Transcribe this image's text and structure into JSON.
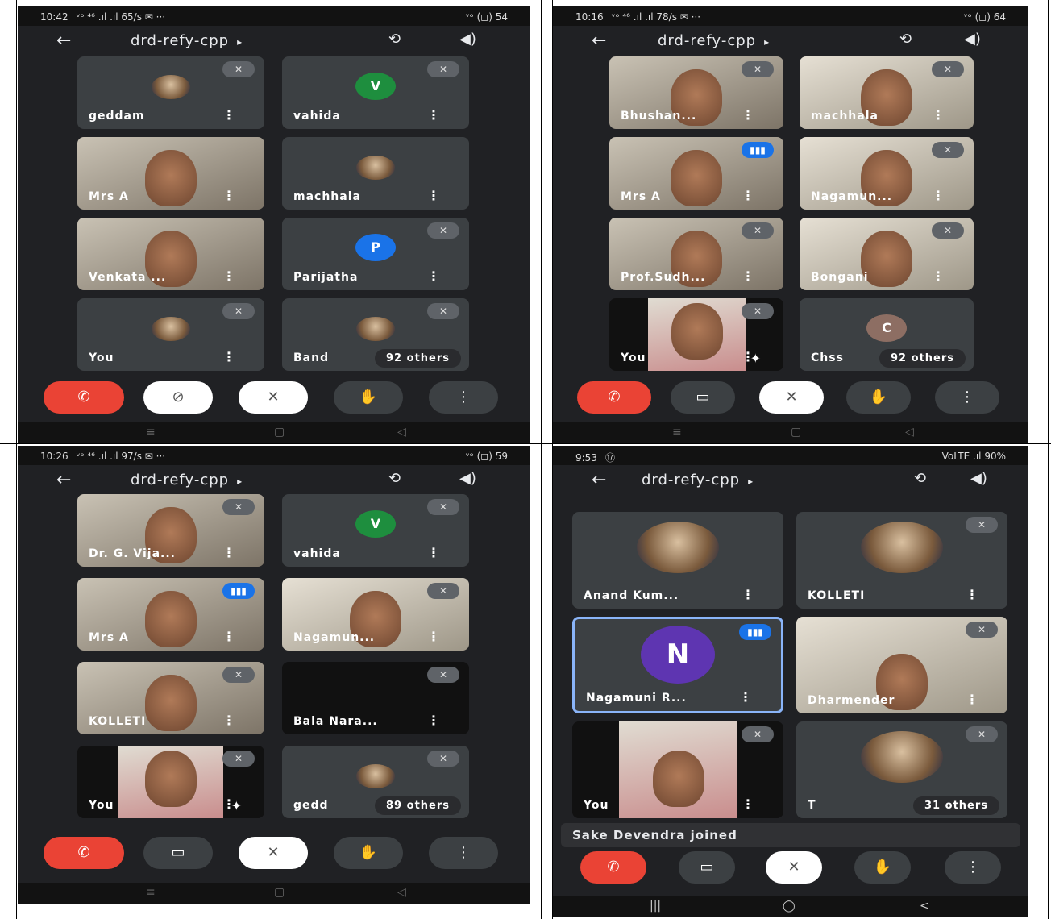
{
  "meeting": {
    "title": "drd-refy-cpp",
    "title_arrow": "▸"
  },
  "icons": {
    "back": "back-arrow-icon",
    "flip": "camera-flip-icon",
    "speaker": "speaker-icon",
    "mic_off": "mic-off-icon",
    "more": "more-vert-icon"
  },
  "glyphs": {
    "back": "←",
    "flip": "⟲",
    "speaker": "◀)",
    "mic_off": "✕",
    "dots": "⋮",
    "speaking": "▮▮▮",
    "end": "✆",
    "cam": "▭",
    "cam_off": "⊘",
    "hand": "✋",
    "more": "⋮",
    "sparkle": "✦",
    "nav_menu": "≡",
    "nav_home": "▢",
    "nav_back": "◁",
    "nav_recents": "|||",
    "nav_home2": "◯",
    "nav_back2": "<"
  },
  "panels": [
    {
      "status_time": "10:42",
      "status_icons": "ᵛᵒ ⁴⁶ .ıl .ıl 65/s ✉ ···",
      "status_right": "ᵛᵒ (◻) 54",
      "tiles": [
        {
          "name": "geddam",
          "avatar": "photo",
          "muted": true
        },
        {
          "name": "vahida",
          "avatar_letter": "V",
          "avatar_color": "#1e8e3e",
          "muted": true
        },
        {
          "name": "Mrs A",
          "video": true,
          "muted": false
        },
        {
          "name": "machhala",
          "avatar": "photo",
          "muted": false
        },
        {
          "name": "Venkata ...",
          "video": true,
          "muted": false
        },
        {
          "name": "Parijatha",
          "avatar_letter": "P",
          "avatar_color": "#1a73e8",
          "muted": true
        },
        {
          "name": "You",
          "avatar": "photo",
          "muted": true
        },
        {
          "name": "Band",
          "avatar": "photo",
          "muted": true,
          "others": "92 others"
        }
      ]
    },
    {
      "status_time": "10:16",
      "status_icons": "ᵛᵒ ⁴⁶ .ıl .ıl 78/s ✉ ···",
      "status_right": "ᵛᵒ (◻) 64",
      "tiles": [
        {
          "name": "Bhushan...",
          "video": true,
          "muted": true
        },
        {
          "name": "machhala",
          "video": true,
          "muted": true
        },
        {
          "name": "Mrs A",
          "video": true,
          "speaking": true
        },
        {
          "name": "Nagamun...",
          "video": true,
          "muted": true
        },
        {
          "name": "Prof.Sudh...",
          "video": true,
          "muted": true
        },
        {
          "name": "Bongani",
          "video": true,
          "muted": true
        },
        {
          "name": "You",
          "self_video": true,
          "muted": true
        },
        {
          "name": "Chss",
          "avatar_letter": "C",
          "avatar_color": "#8d6e63",
          "others": "92 others"
        }
      ]
    },
    {
      "status_time": "10:26",
      "status_icons": "ᵛᵒ ⁴⁶ .ıl .ıl 97/s ✉ ···",
      "status_right": "ᵛᵒ (◻) 59",
      "tiles": [
        {
          "name": "Dr. G. Vija...",
          "video": true,
          "muted": true
        },
        {
          "name": "vahida",
          "avatar_letter": "V",
          "avatar_color": "#1e8e3e",
          "muted": true
        },
        {
          "name": "Mrs A",
          "video": true,
          "speaking": true
        },
        {
          "name": "Nagamun...",
          "video": true,
          "muted": true
        },
        {
          "name": "KOLLETI",
          "video": true,
          "muted": true
        },
        {
          "name": "Bala Nara...",
          "dark": true,
          "muted": true
        },
        {
          "name": "You",
          "self_video": true,
          "muted": true
        },
        {
          "name": "gedd",
          "avatar": "photo",
          "muted": true,
          "others": "89 others"
        }
      ]
    },
    {
      "status_time": "9:53",
      "status_icons": "⑰",
      "status_right": "VoLTE .ıl 90%",
      "tiles": [
        {
          "name": "Anand Kum...",
          "avatar": "photo",
          "muted": false
        },
        {
          "name": "KOLLETI",
          "avatar": "photo",
          "muted": true
        },
        {
          "name": "Nagamuni R...",
          "avatar_letter": "N",
          "avatar_color": "#5e35b1",
          "speaking": true,
          "selected": true
        },
        {
          "name": "Dharmender",
          "video": true,
          "muted": true
        },
        {
          "name": "You",
          "self_video": true,
          "muted": true
        },
        {
          "name": "T",
          "avatar": "photo",
          "muted": true,
          "others": "31 others"
        }
      ],
      "toast": "Sake Devendra joined"
    }
  ]
}
